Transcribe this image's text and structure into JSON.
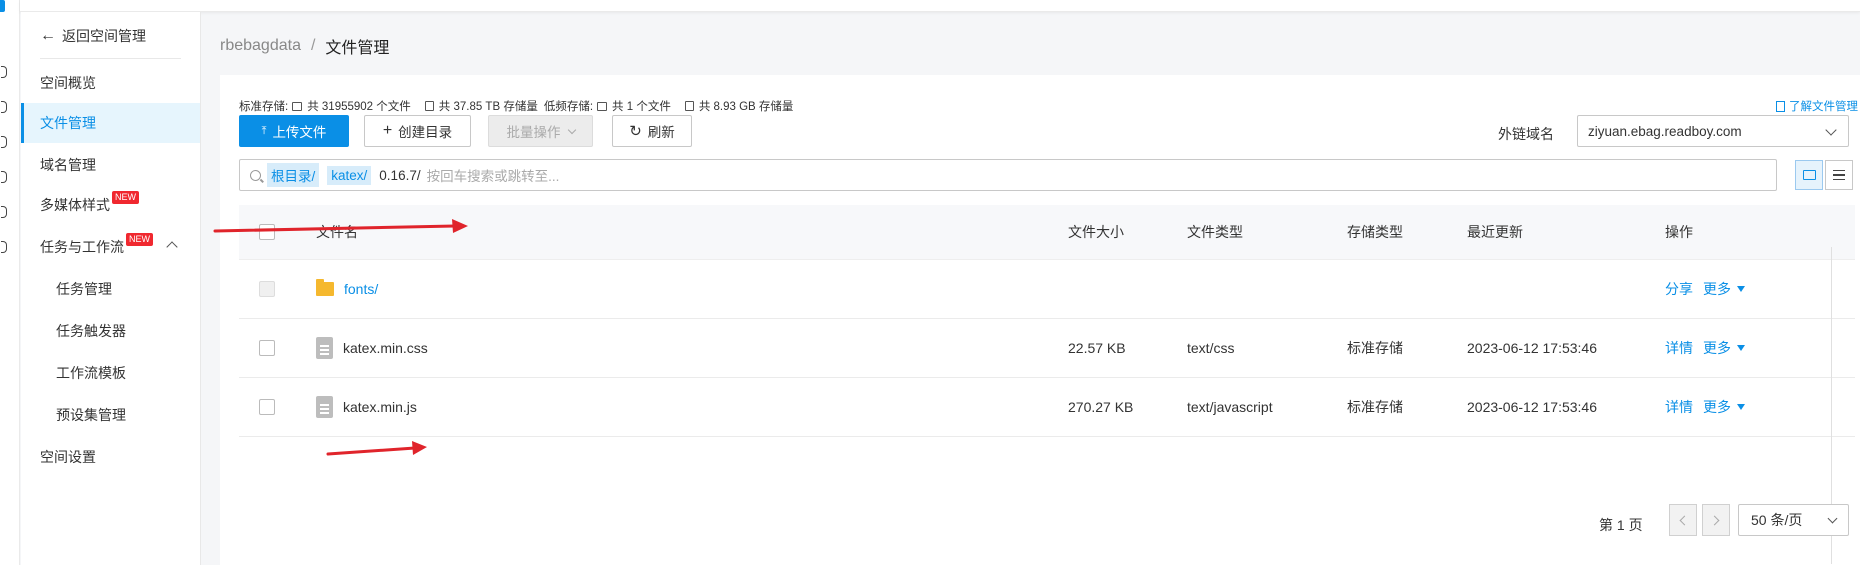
{
  "sidebar": {
    "back_label": "返回空间管理",
    "items": [
      {
        "label": "空间概览"
      },
      {
        "label": "文件管理"
      },
      {
        "label": "域名管理"
      },
      {
        "label": "多媒体样式",
        "badge": "NEW"
      },
      {
        "label": "任务与工作流",
        "badge": "NEW"
      },
      {
        "label": "任务管理"
      },
      {
        "label": "任务触发器"
      },
      {
        "label": "工作流模板"
      },
      {
        "label": "预设集管理"
      },
      {
        "label": "空间设置"
      }
    ]
  },
  "breadcrumb": {
    "root": "rbebagdata",
    "separator": "/",
    "current": "文件管理"
  },
  "stats": {
    "standard_label": "标准存储:",
    "standard_files": "共 31955902 个文件",
    "standard_size": "共 37.85 TB 存储量",
    "infrequent_label": "低频存储:",
    "infrequent_files": "共 1 个文件",
    "infrequent_size": "共 8.93 GB 存储量"
  },
  "learn_link": "了解文件管理",
  "toolbar": {
    "upload": "上传文件",
    "mkdir": "创建目录",
    "batch": "批量操作",
    "refresh": "刷新",
    "domain_label": "外链域名",
    "domain_value": "ziyuan.ebag.readboy.com"
  },
  "path": {
    "chips": [
      "根目录/",
      "katex/"
    ],
    "current": "0.16.7/",
    "placeholder": "按回车搜索或跳转至..."
  },
  "table": {
    "headers": {
      "name": "文件名",
      "size": "文件大小",
      "type": "文件类型",
      "storage": "存储类型",
      "updated": "最近更新",
      "ops": "操作"
    },
    "rows": [
      {
        "name": "fonts/",
        "kind": "folder",
        "size": "",
        "type": "",
        "storage": "",
        "updated": "",
        "op1": "分享",
        "op2": "更多"
      },
      {
        "name": "katex.min.css",
        "kind": "file",
        "size": "22.57 KB",
        "type": "text/css",
        "storage": "标准存储",
        "updated": "2023-06-12 17:53:46",
        "op1": "详情",
        "op2": "更多"
      },
      {
        "name": "katex.min.js",
        "kind": "file",
        "size": "270.27 KB",
        "type": "text/javascript",
        "storage": "标准存储",
        "updated": "2023-06-12 17:53:46",
        "op1": "详情",
        "op2": "更多"
      }
    ]
  },
  "pagination": {
    "page_label": "第 1 页",
    "page_size": "50 条/页"
  },
  "colors": {
    "accent": "#0a8fe6",
    "annotation_arrow": "#e0242b",
    "folder": "#f5b82e"
  }
}
